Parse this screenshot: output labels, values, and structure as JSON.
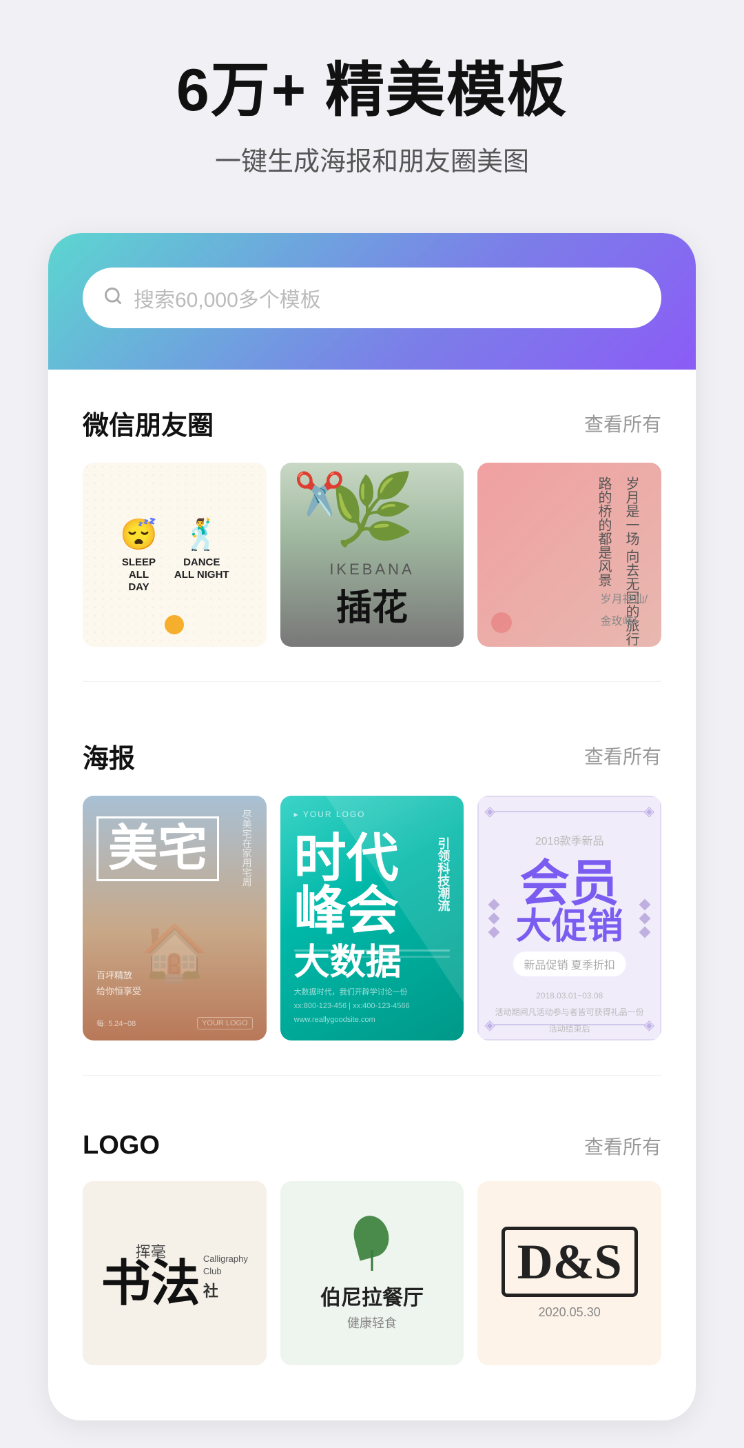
{
  "hero": {
    "title": "6万+ 精美模板",
    "subtitle": "一键生成海报和朋友圈美图"
  },
  "search": {
    "placeholder": "搜索60,000多个模板"
  },
  "sections": [
    {
      "id": "wechat",
      "title": "微信朋友圈",
      "viewAll": "查看所有"
    },
    {
      "id": "poster",
      "title": "海报",
      "viewAll": "查看所有"
    },
    {
      "id": "logo",
      "title": "LOGO",
      "viewAll": "查看所有"
    }
  ],
  "wechat_templates": [
    {
      "type": "sleep-dance",
      "label1": "SLEEP\nALL\nDAY",
      "label2": "DANCE\nALL NIGHT",
      "emoji1": "😴",
      "emoji2": "🕺"
    },
    {
      "type": "ikebana",
      "en_label": "IKEBANA",
      "cn_label": "插花"
    },
    {
      "type": "poem",
      "lines": [
        "岁月是一场",
        "向去无回的旅行",
        "路的桥的都是风景"
      ],
      "author1": "岁月神仙/",
      "author2": "金玫岐/"
    }
  ],
  "poster_templates": [
    {
      "type": "real-estate",
      "title": "美宅",
      "subtitle": "尽美宅在家用宅周",
      "logo": "YOUR LOGO"
    },
    {
      "type": "bigdata",
      "line1": "大",
      "line2": "数据",
      "line3": "时代峰会",
      "sub": "引领科技潮流",
      "desc": "大数据"
    },
    {
      "type": "member-sale",
      "year": "2018款季新品",
      "title1": "会员",
      "title2": "大促销",
      "sub": "新品促销 夏季折扣"
    }
  ],
  "logo_templates": [
    {
      "type": "calligraphy",
      "cn": "书法",
      "cn_big": "挥毫",
      "en_line1": "Calligraphy",
      "en_line2": "Club",
      "cn_small": "社"
    },
    {
      "type": "restaurant",
      "name_cn": "伯尼拉餐厅",
      "sub_cn": "健康轻食"
    },
    {
      "type": "ds",
      "letters": "D&S",
      "date": "2020.05.30"
    }
  ],
  "colors": {
    "gradient_start": "#5cd6d0",
    "gradient_end": "#8b5cf6",
    "accent_purple": "#7b5cf0",
    "text_dark": "#111111",
    "text_gray": "#999999"
  }
}
